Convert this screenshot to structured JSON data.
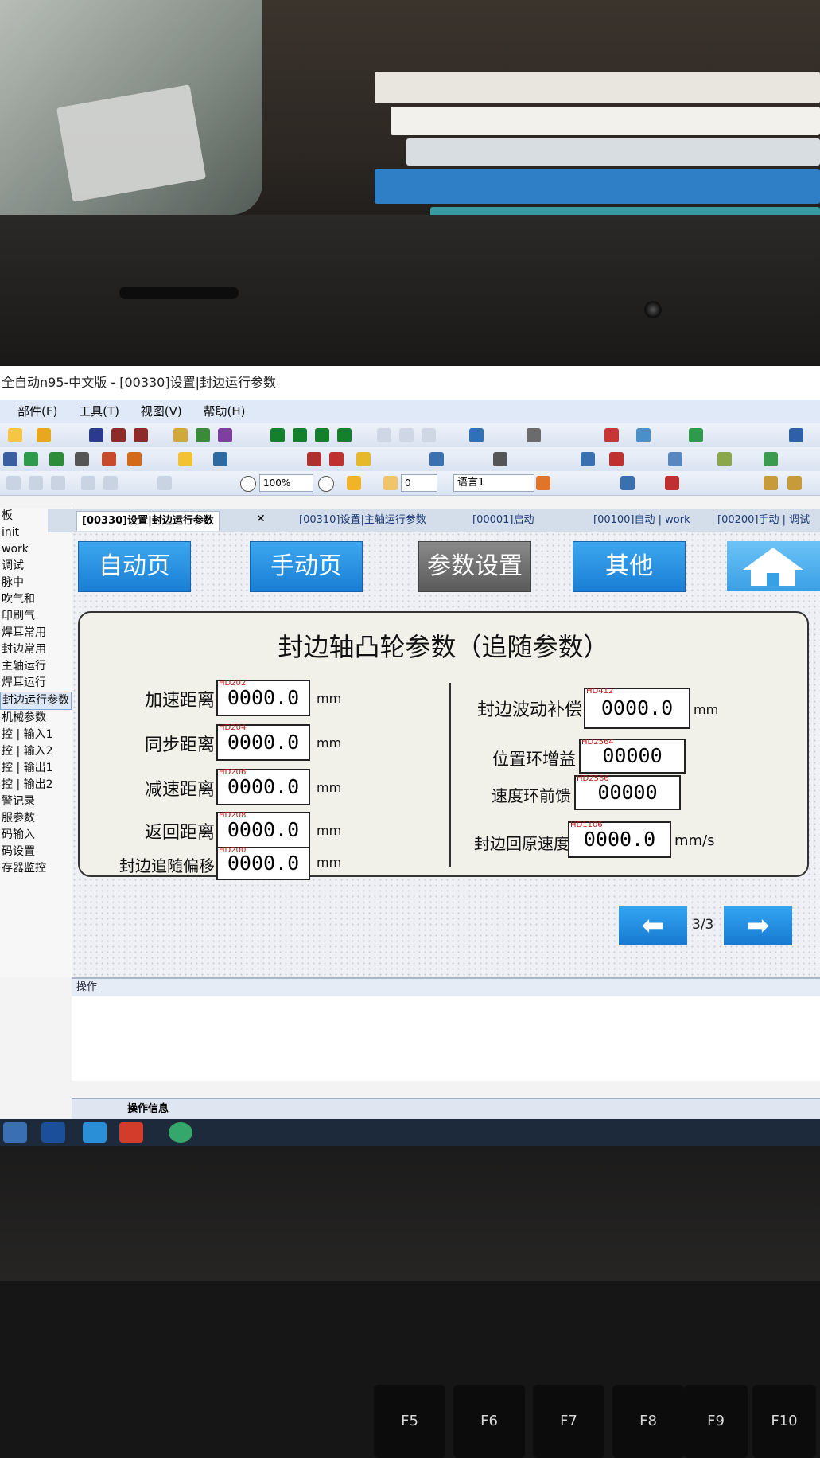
{
  "window": {
    "title": "全自动n95-中文版 - [00330]设置|封边运行参数"
  },
  "menu": {
    "items": [
      "部件(F)",
      "工具(T)",
      "视图(V)",
      "帮助(H)"
    ]
  },
  "toolbar": {
    "zoom": "100%",
    "number": "0",
    "language": "语言1"
  },
  "sidebar": {
    "items": [
      "板",
      "init",
      "work",
      "调试",
      "脉中",
      "吹气和",
      "印刷气",
      "焊耳常用",
      "封边常用",
      "主轴运行",
      "焊耳运行",
      "封边运行参数",
      "机械参数",
      "控 | 输入1",
      "控 | 输入2",
      "控 | 输出1",
      "控 | 输出2",
      "警记录",
      "服参数",
      "码输入",
      "码设置",
      "存器监控"
    ],
    "selected_index": 11
  },
  "tabs": [
    {
      "label": "[00330]设置|封边运行参数",
      "active": true
    },
    {
      "label": "[00310]设置|主轴运行参数",
      "active": false
    },
    {
      "label": "[00001]启动",
      "active": false
    },
    {
      "label": "[00100]自动 | work",
      "active": false
    },
    {
      "label": "[00200]手动 | 调试",
      "active": false
    }
  ],
  "hmi": {
    "nav": {
      "auto": "自动页",
      "manual": "手动页",
      "params": "参数设置",
      "other": "其他"
    },
    "panel_title": "封边轴凸轮参数（追随参数）",
    "left_params": [
      {
        "label": "加速距离",
        "addr": "HD202",
        "value": "0000.0",
        "unit": "mm"
      },
      {
        "label": "同步距离",
        "addr": "HD204",
        "value": "0000.0",
        "unit": "mm"
      },
      {
        "label": "减速距离",
        "addr": "HD206",
        "value": "0000.0",
        "unit": "mm"
      },
      {
        "label": "返回距离",
        "addr": "HD208",
        "value": "0000.0",
        "unit": "mm"
      },
      {
        "label": "封边追随偏移",
        "addr": "HD200",
        "value": "0000.0",
        "unit": "mm"
      }
    ],
    "right_params": [
      {
        "label": "封边波动补偿",
        "addr": "HD412",
        "value": "0000.0",
        "unit": "mm"
      },
      {
        "label": "位置环增益",
        "addr": "HD2564",
        "value": "00000",
        "unit": ""
      },
      {
        "label": "速度环前馈",
        "addr": "HD2566",
        "value": "00000",
        "unit": ""
      },
      {
        "label": "封边回原速度",
        "addr": "HD1106",
        "value": "0000.0",
        "unit": "mm/s"
      }
    ],
    "pager": "3/3"
  },
  "panes": {
    "ops_header": "操作",
    "ops_tab": "操作信息"
  },
  "keys": [
    "F5",
    "F6",
    "F7",
    "F8",
    "F9",
    "F10"
  ],
  "colors": {
    "nav_blue": "#1a7ed4",
    "nav_gray": "#5a5a5a",
    "address_red": "#c01818"
  }
}
